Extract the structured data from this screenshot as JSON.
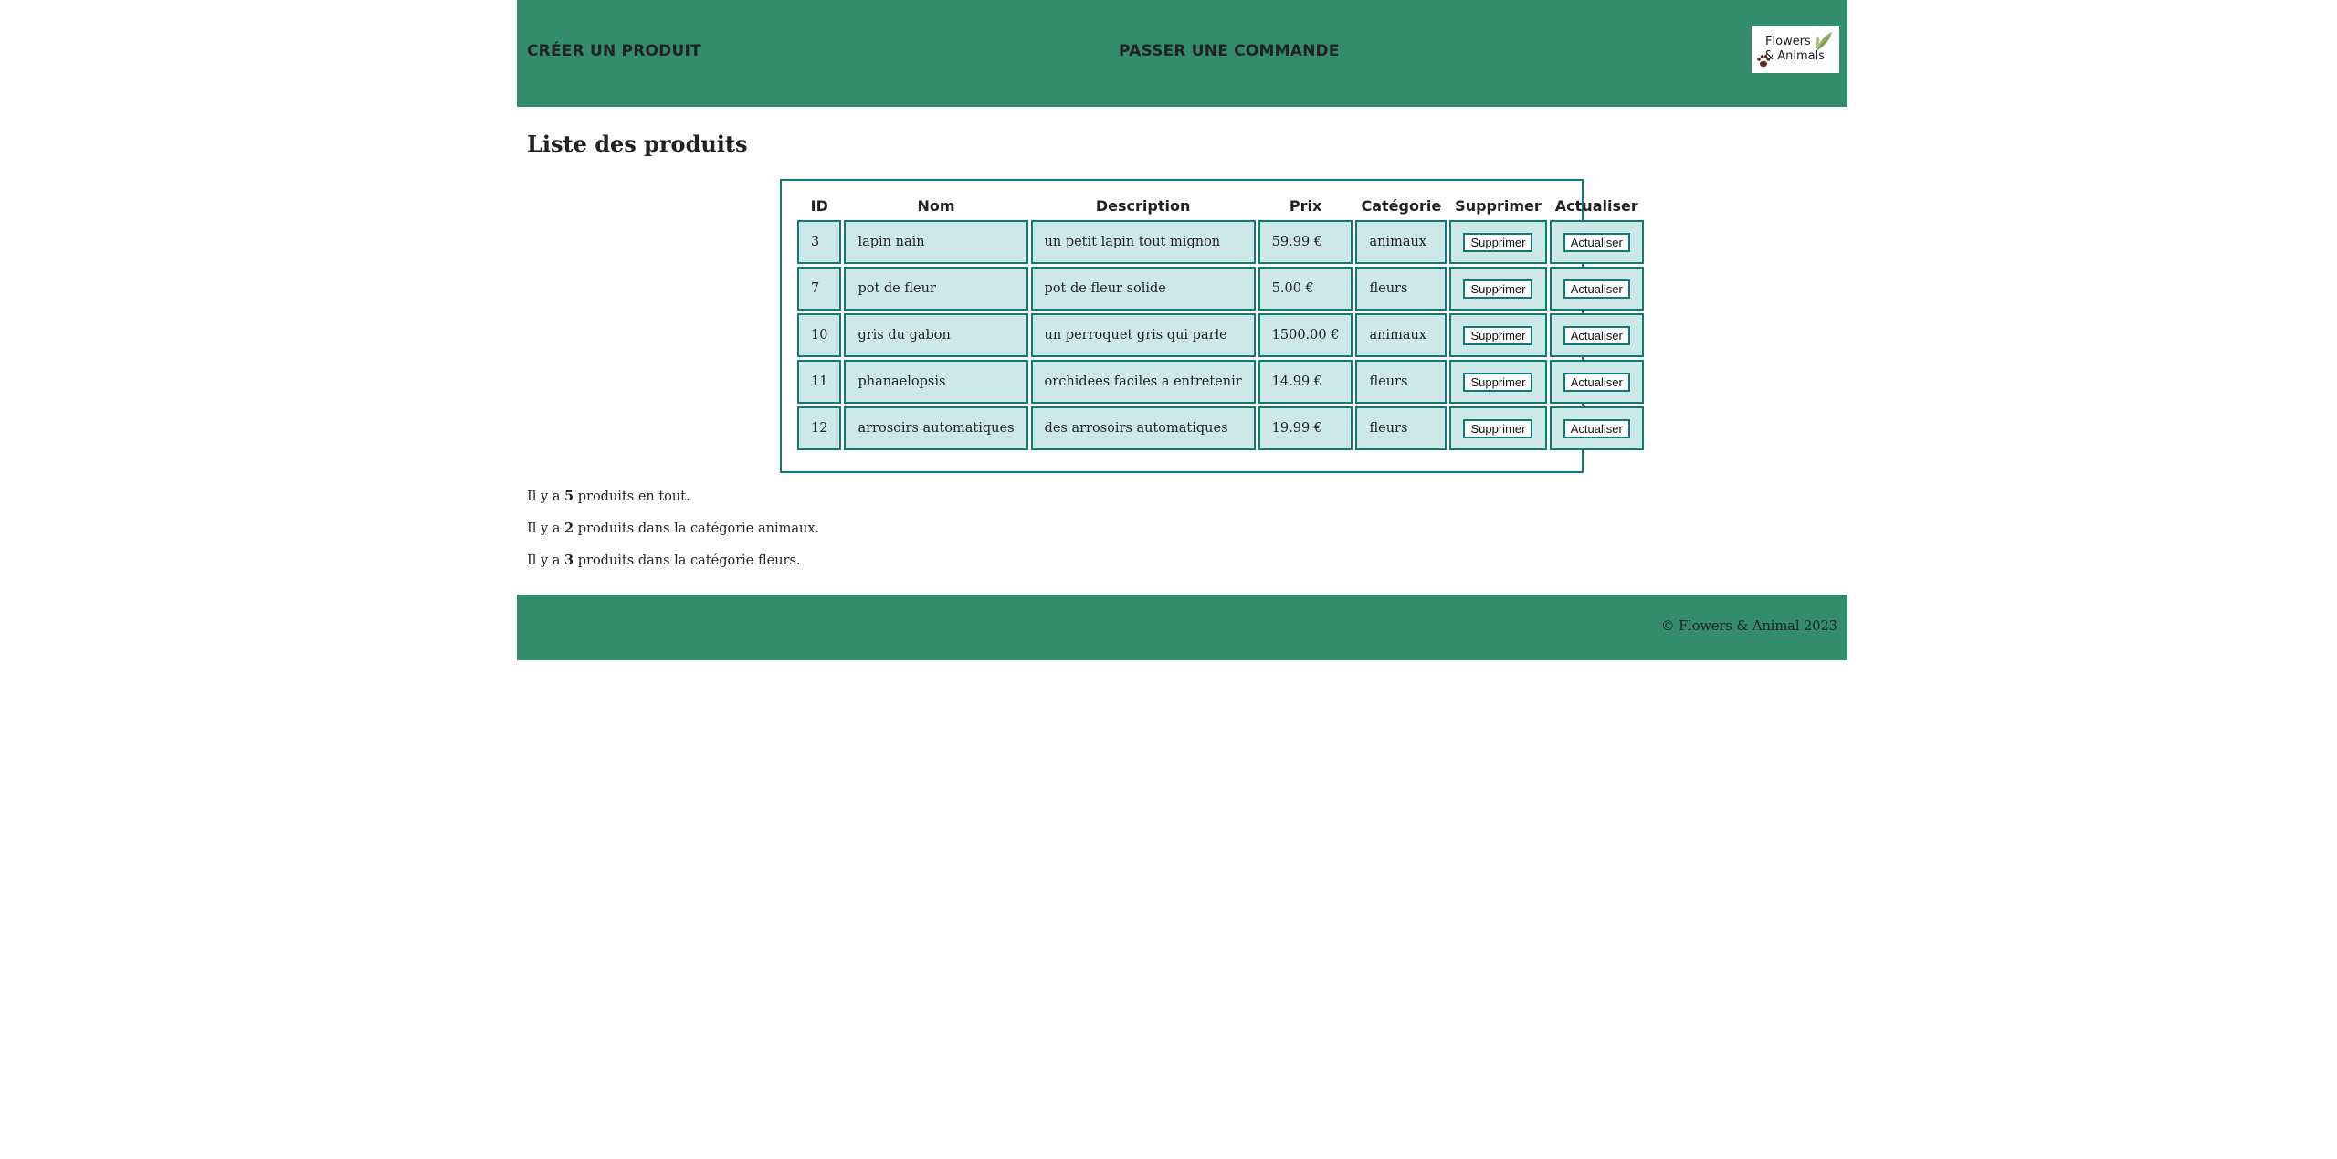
{
  "header": {
    "nav_create": "CRÉER UN PRODUIT",
    "nav_order": "PASSER UNE COMMANDE",
    "logo_line1": "Flowers",
    "logo_line2": "& Animals",
    "color": "#338c6c"
  },
  "main": {
    "title": "Liste des produits",
    "table": {
      "columns": [
        "ID",
        "Nom",
        "Description",
        "Prix",
        "Catégorie",
        "Supprimer",
        "Actualiser"
      ],
      "delete_label": "Supprimer",
      "update_label": "Actualiser",
      "rows": [
        {
          "id": "3",
          "nom": "lapin nain",
          "description": "un petit lapin tout mignon",
          "prix": "59.99 €",
          "categorie": "animaux"
        },
        {
          "id": "7",
          "nom": "pot de fleur",
          "description": "pot de fleur solide",
          "prix": "5.00 €",
          "categorie": "fleurs"
        },
        {
          "id": "10",
          "nom": "gris du gabon",
          "description": "un perroquet gris qui parle",
          "prix": "1500.00 €",
          "categorie": "animaux"
        },
        {
          "id": "11",
          "nom": "phanaelopsis",
          "description": "orchidees faciles a entretenir",
          "prix": "14.99 €",
          "categorie": "fleurs"
        },
        {
          "id": "12",
          "nom": "arrosoirs automatiques",
          "description": "des arrosoirs automatiques",
          "prix": "19.99 €",
          "categorie": "fleurs"
        }
      ],
      "cell_color": "#cde8e8",
      "border_color": "#0f7a78"
    },
    "summary": {
      "total_prefix": "Il y a ",
      "total_count": "5",
      "total_suffix": " produits en tout.",
      "animaux_prefix": "Il y a ",
      "animaux_count": "2",
      "animaux_suffix": " produits dans la catégorie animaux.",
      "fleurs_prefix": "Il y a ",
      "fleurs_count": "3",
      "fleurs_suffix": " produits dans la catégorie fleurs."
    }
  },
  "footer": {
    "copyright": "© Flowers & Animal 2023"
  }
}
